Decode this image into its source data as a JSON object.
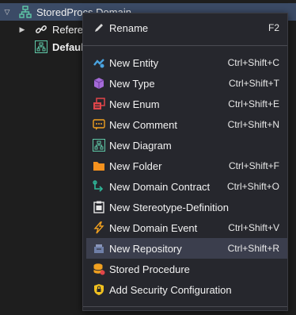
{
  "tree": {
    "root_label": "StoredProcs.Domain",
    "child1_label": "References",
    "child2_label": "Default"
  },
  "menu": {
    "items": [
      {
        "label": "Rename",
        "shortcut": "F2",
        "icon": "pencil-icon"
      },
      {
        "label": "New Entity",
        "shortcut": "Ctrl+Shift+C",
        "icon": "entity-icon"
      },
      {
        "label": "New Type",
        "shortcut": "Ctrl+Shift+T",
        "icon": "type-cube-icon"
      },
      {
        "label": "New Enum",
        "shortcut": "Ctrl+Shift+E",
        "icon": "enum-icon"
      },
      {
        "label": "New Comment",
        "shortcut": "Ctrl+Shift+N",
        "icon": "comment-icon"
      },
      {
        "label": "New Diagram",
        "shortcut": "",
        "icon": "diagram-icon"
      },
      {
        "label": "New Folder",
        "shortcut": "Ctrl+Shift+F",
        "icon": "folder-icon"
      },
      {
        "label": "New Domain Contract",
        "shortcut": "Ctrl+Shift+O",
        "icon": "contract-icon"
      },
      {
        "label": "New Stereotype-Definition",
        "shortcut": "",
        "icon": "stereotype-icon"
      },
      {
        "label": "New Domain Event",
        "shortcut": "Ctrl+Shift+V",
        "icon": "lightning-icon"
      },
      {
        "label": "New Repository",
        "shortcut": "Ctrl+Shift+R",
        "icon": "repository-icon"
      },
      {
        "label": "Stored Procedure",
        "shortcut": "",
        "icon": "database-icon"
      },
      {
        "label": "Add Security Configuration",
        "shortcut": "",
        "icon": "shield-icon"
      }
    ]
  },
  "colors": {
    "selection": "#3b4b66",
    "menu_bg": "#26272d",
    "hover": "#3b3e4d"
  }
}
